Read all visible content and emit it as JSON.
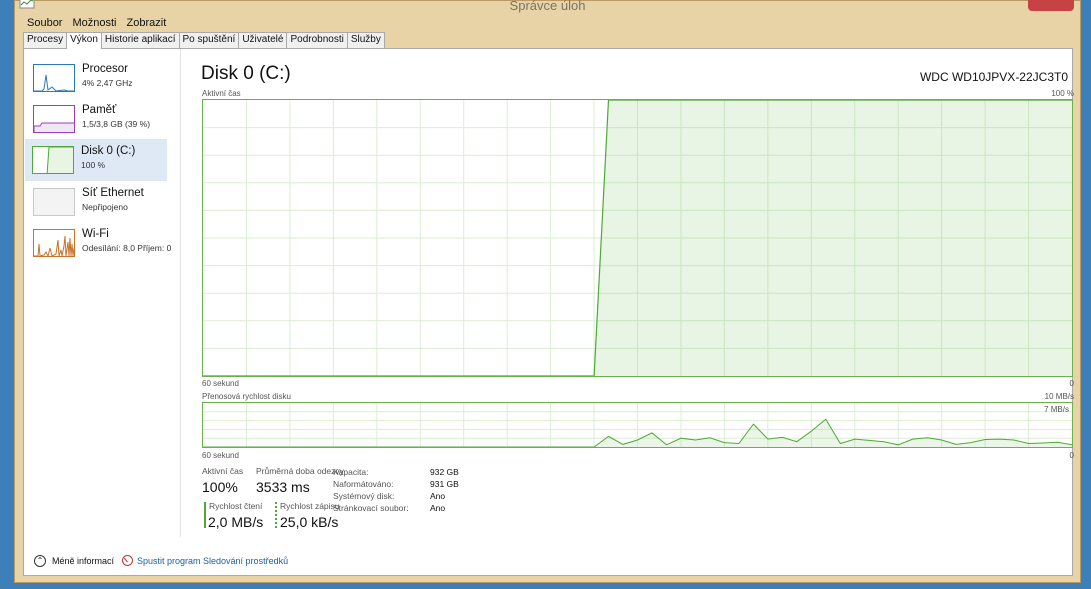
{
  "window": {
    "title": "Správce úloh"
  },
  "menu": [
    "Soubor",
    "Možnosti",
    "Zobrazit"
  ],
  "tabs": [
    "Procesy",
    "Výkon",
    "Historie aplikací",
    "Po spuštění",
    "Uživatelé",
    "Podrobnosti",
    "Služby"
  ],
  "active_tab": "Výkon",
  "sidebar": [
    {
      "name": "Procesor",
      "sub": "4% 2,47 GHz",
      "color": "#2a7ab8"
    },
    {
      "name": "Paměť",
      "sub": "1,5/3,8 GB (39 %)",
      "color": "#9b3fb8"
    },
    {
      "name": "Disk 0 (C:)",
      "sub": "100 %",
      "color": "#4fa837"
    },
    {
      "name": "Síť Ethernet",
      "sub": "Nepřipojeno",
      "color": "#b0b0b0"
    },
    {
      "name": "Wi-Fi",
      "sub": "Odesílání: 8,0  Příjem: 0",
      "color": "#c8742a"
    }
  ],
  "main": {
    "title": "Disk 0 (C:)",
    "model": "WDC WD10JPVX-22JC3T0",
    "chart1": {
      "label": "Aktivní čas",
      "max": "100 %",
      "x_left": "60 sekund",
      "x_right": "0"
    },
    "chart2": {
      "label": "Přenosová rychlost disku",
      "max": "10 MB/s",
      "inner_max": "7 MB/s",
      "x_left": "60 sekund",
      "x_right": "0"
    }
  },
  "chart_data": [
    {
      "type": "area",
      "ylabel": "Aktivní čas",
      "ylim": [
        0,
        100
      ],
      "x": [
        60,
        58,
        56,
        54,
        52,
        50,
        48,
        46,
        44,
        42,
        40,
        38,
        36,
        35,
        34,
        33,
        32,
        30,
        28,
        26,
        24,
        22,
        20,
        18,
        16,
        14,
        12,
        10,
        8,
        6,
        4,
        2,
        0
      ],
      "values": [
        0,
        0,
        0,
        0,
        0,
        0,
        0,
        0,
        0,
        0,
        0,
        0,
        0,
        0,
        0,
        0,
        100,
        100,
        100,
        100,
        100,
        100,
        100,
        100,
        100,
        100,
        100,
        100,
        100,
        100,
        100,
        100,
        100
      ]
    },
    {
      "type": "line",
      "ylabel": "Přenosová rychlost disku",
      "ylim": [
        0,
        10
      ],
      "x": [
        60,
        57,
        54,
        51,
        48,
        45,
        42,
        39,
        36,
        34,
        33,
        32,
        31,
        30,
        29,
        28,
        27,
        26,
        25,
        24,
        23,
        22,
        21,
        20,
        19,
        18,
        17,
        16,
        15,
        14,
        13,
        12,
        11,
        10,
        9,
        8,
        7,
        6,
        5,
        4,
        3,
        2,
        1,
        0
      ],
      "values": [
        0,
        0,
        0,
        0,
        0,
        0,
        0,
        0,
        0,
        0,
        0,
        2.4,
        0.6,
        1.6,
        3.2,
        0.5,
        2.0,
        1.6,
        2.1,
        1.0,
        0.8,
        5.2,
        1.8,
        2.2,
        1.2,
        3.6,
        6.3,
        0.8,
        1.8,
        1.5,
        1.2,
        0.5,
        1.8,
        2.1,
        1.6,
        0.6,
        1.0,
        1.7,
        1.8,
        1.6,
        0.8,
        0.9,
        1.1,
        0.5
      ]
    }
  ],
  "stats": {
    "active_label": "Aktivní čas",
    "active_val": "100%",
    "resp_label": "Průměrná doba odezvy",
    "resp_val": "3533 ms",
    "read_label": "Rychlost čtení",
    "read_val": "2,0 MB/s",
    "write_label": "Rychlost zápisu",
    "write_val": "25,0 kB/s",
    "kv": [
      {
        "k": "Kapacita:",
        "v": "932 GB"
      },
      {
        "k": "Naformátováno:",
        "v": "931 GB"
      },
      {
        "k": "Systémový disk:",
        "v": "Ano"
      },
      {
        "k": "Stránkovací soubor:",
        "v": "Ano"
      }
    ]
  },
  "footer": {
    "less": "Méně informací",
    "resmon": "Spustit program Sledování prostředků"
  }
}
